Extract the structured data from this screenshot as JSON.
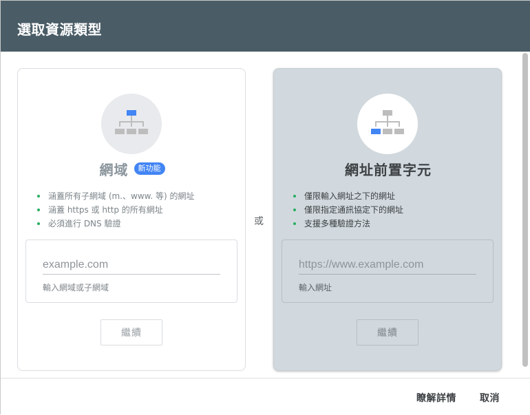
{
  "dialog": {
    "title": "選取資源類型",
    "or_label": "或"
  },
  "domain_card": {
    "icon": "sitemap-icon",
    "title": "網域",
    "badge": "新功能",
    "features": [
      "涵蓋所有子網域 (m.、www. 等) 的網址",
      "涵蓋 https 或 http 的所有網址",
      "必須進行 DNS 驗證"
    ],
    "input_value": "",
    "input_placeholder": "example.com",
    "input_helper": "輸入網域或子網域",
    "continue_label": "繼續"
  },
  "prefix_card": {
    "icon": "sitemap-icon",
    "title": "網址前置字元",
    "features": [
      "僅限輸入網址之下的網址",
      "僅限指定通訊協定下的網址",
      "支援多種驗證方法"
    ],
    "input_value": "",
    "input_placeholder": "https://www.example.com",
    "input_helper": "輸入網址",
    "continue_label": "繼續"
  },
  "footer": {
    "learn_more_label": "瞭解詳情",
    "cancel_label": "取消"
  },
  "colors": {
    "header": "#4a5d67",
    "accent": "#4285f4",
    "prefix_card_bg": "#d1d9de",
    "bullet": "#27ae60"
  }
}
